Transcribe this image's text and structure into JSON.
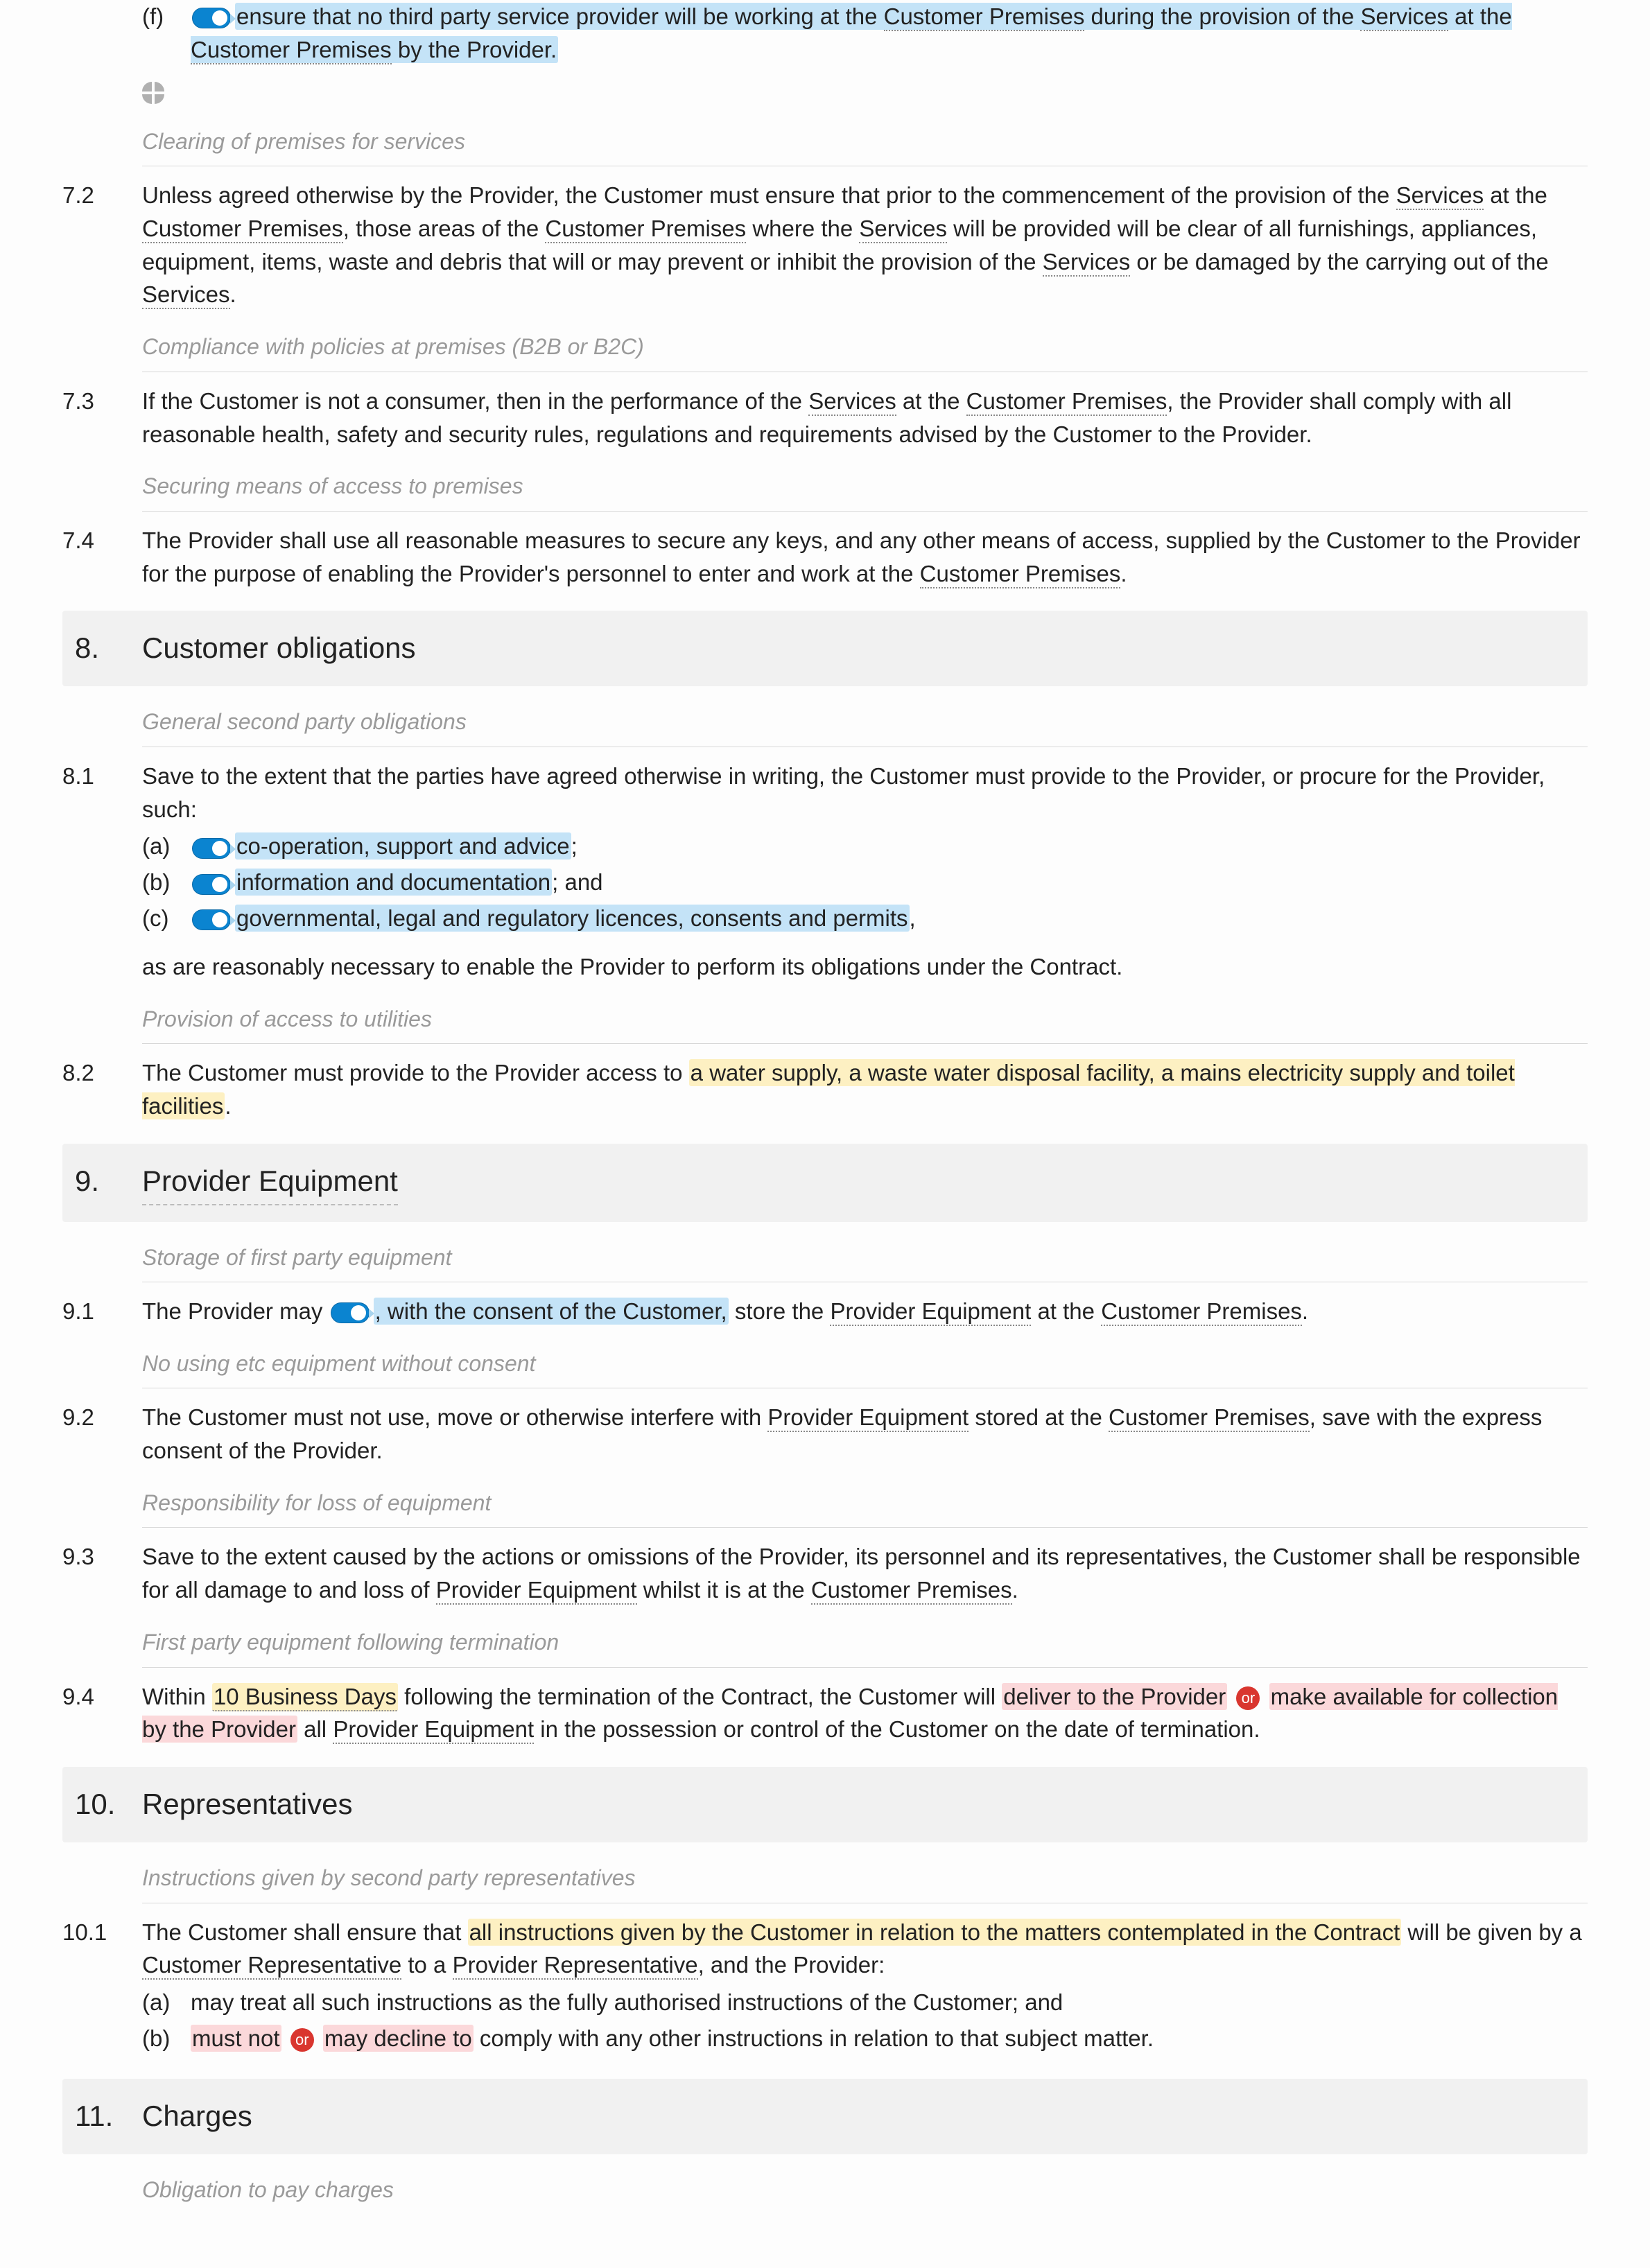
{
  "clause_f": {
    "letter": "(f)",
    "before": "ensure that no third party service provider will be working at the ",
    "cp": "Customer Premises",
    "mid": " during the provision of the ",
    "srv": "Services",
    "mid2": " at the ",
    "end": " by the Provider."
  },
  "note_72": "Clearing of premises for services",
  "c72": {
    "num": "7.2",
    "p1": "Unless agreed otherwise by the Provider, the Customer must ensure that prior to the commencement of the provision of the ",
    "srv": "Services",
    "p2": " at the ",
    "cp": "Customer Premises",
    "p3": ", those areas of the ",
    "p4": " where the ",
    "p5": " will be provided will be clear of all furnishings, appliances, equipment, items, waste and debris that will or may prevent or inhibit the provision of the ",
    "p6": " or be damaged by the carrying out of the ",
    "p7": "."
  },
  "note_73": "Compliance with policies at premises (B2B or B2C)",
  "c73": {
    "num": "7.3",
    "p1": "If the Customer is not a consumer, then in the performance of the ",
    "srv": "Services",
    "p2": " at the ",
    "cp": "Customer Premises",
    "p3": ", the Provider shall comply with all reasonable health, safety and security rules, regulations and requirements advised by the Customer to the Provider."
  },
  "note_74": "Securing means of access to premises",
  "c74": {
    "num": "7.4",
    "p1": "The Provider shall use all reasonable measures to secure any keys, and any other means of access, supplied by the Customer to the Provider for the purpose of enabling the Provider's personnel to enter and work at the ",
    "cp": "Customer Premises",
    "p2": "."
  },
  "s8": {
    "num": "8.",
    "title": "Customer obligations"
  },
  "note_81": "General second party obligations",
  "c81": {
    "num": "8.1",
    "intro": "Save to the extent that the parties have agreed otherwise in writing, the Customer must provide to the Provider, or procure for the Provider, such:",
    "a_letter": "(a)",
    "a": "co-operation, support and advice",
    "a_after": ";",
    "b_letter": "(b)",
    "b": "information and documentation",
    "b_after": "; and",
    "c_letter": "(c)",
    "c": "governmental, legal and regulatory licences, consents and permits",
    "c_after": ",",
    "outro": "as are reasonably necessary to enable the Provider to perform its obligations under the Contract."
  },
  "note_82": "Provision of access to utilities",
  "c82": {
    "num": "8.2",
    "p1": "The Customer must provide to the Provider access to ",
    "yellow": "a water supply, a waste water disposal facility, a mains electricity supply and toilet facilities",
    "p2": "."
  },
  "s9": {
    "num": "9.",
    "title": "Provider Equipment"
  },
  "note_91": "Storage of first party equipment",
  "c91": {
    "num": "9.1",
    "p1": "The Provider may ",
    "blue": ", with the consent of the Customer,",
    "p2": " store the ",
    "pe": "Provider Equipment",
    "p3": " at the ",
    "cp": "Customer Premises",
    "p4": "."
  },
  "note_92": "No using etc equipment without consent",
  "c92": {
    "num": "9.2",
    "p1": "The Customer must not use, move or otherwise interfere with ",
    "pe": "Provider Equipment",
    "p2": " stored at the ",
    "cp": "Customer Premises",
    "p3": ", save with the express consent of the Provider."
  },
  "note_93": "Responsibility for loss of equipment",
  "c93": {
    "num": "9.3",
    "p1": "Save to the extent caused by the actions or omissions of the Provider, its personnel and its representatives, the Customer shall be responsible for all damage to and loss of ",
    "pe": "Provider Equipment",
    "p2": " whilst it is at the ",
    "cp": "Customer Premises",
    "p3": "."
  },
  "note_94": "First party equipment following termination",
  "c94": {
    "num": "9.4",
    "p1": "Within ",
    "bd": "10 Business Days",
    "p2": " following the termination of the Contract, the Customer will ",
    "opt1": "deliver to the Provider",
    "or": "or",
    "opt2": "make available for collection by the Provider",
    "p3": " all ",
    "pe": "Provider Equipment",
    "p4": " in the possession or control of the Customer on the date of termination."
  },
  "s10": {
    "num": "10.",
    "title": "Representatives"
  },
  "note_101": "Instructions given by second party representatives",
  "c101": {
    "num": "10.1",
    "p1": "The Customer shall ensure that ",
    "yellow": "all instructions given by the Customer in relation to the matters contemplated in the Contract",
    "p2": " will be given by a ",
    "cr": "Customer Representative",
    "p3": " to a ",
    "pr": "Provider Representative",
    "p4": ", and the Provider:",
    "a_letter": "(a)",
    "a": "may treat all such instructions as the fully authorised instructions of the Customer; and",
    "b_letter": "(b)",
    "b_opt1": "must not",
    "b_or": "or",
    "b_opt2": "may decline to",
    "b_tail": " comply with any other instructions in relation to that subject matter."
  },
  "s11": {
    "num": "11.",
    "title": "Charges"
  },
  "note_111": "Obligation to pay charges"
}
